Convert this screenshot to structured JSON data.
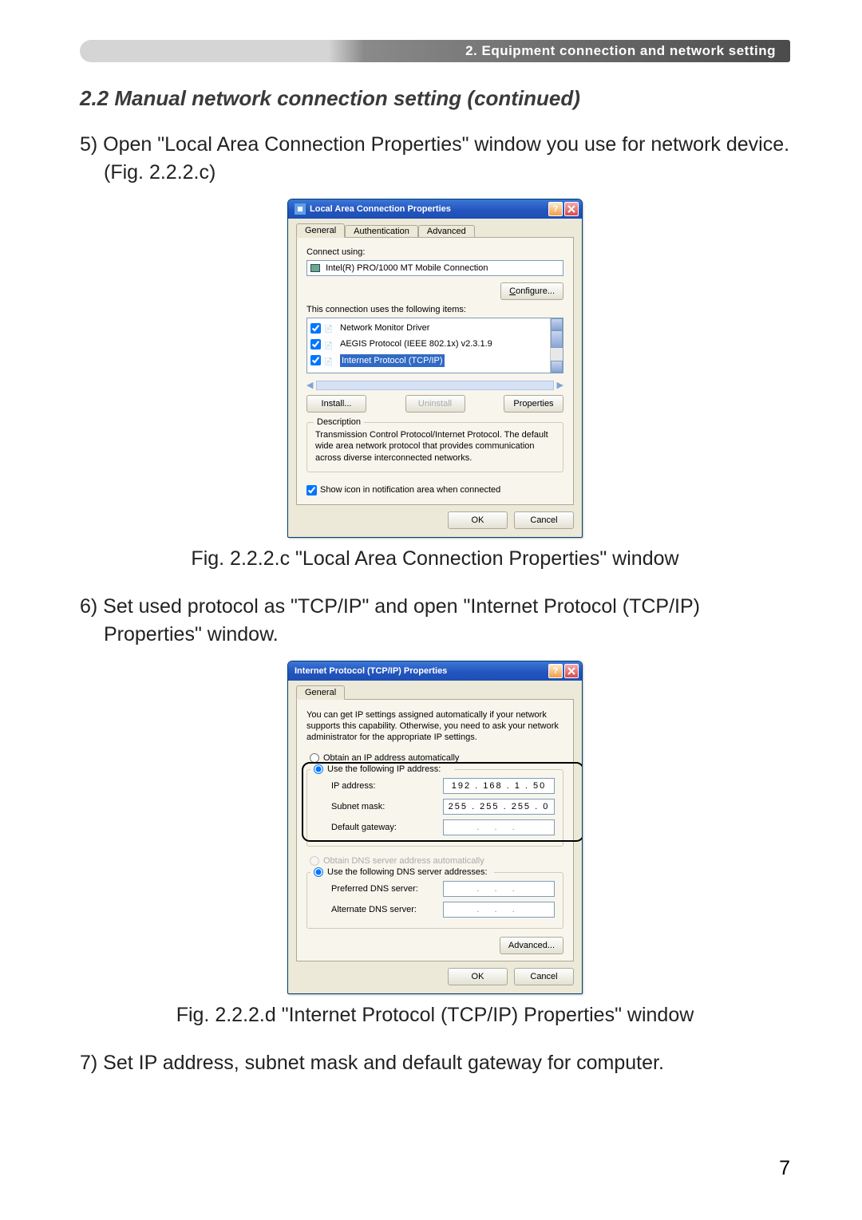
{
  "header": {
    "banner": "2. Equipment connection and network setting"
  },
  "heading": "2.2 Manual network connection setting (continued)",
  "step5": "5) Open \"Local Area Connection Properties\" window you use for network device. (Fig. 2.2.2.c)",
  "caption1": "Fig. 2.2.2.c \"Local Area Connection Properties\" window",
  "step6": "6) Set used protocol as \"TCP/IP\" and open \"Internet Protocol (TCP/IP) Properties\" window.",
  "caption2": "Fig. 2.2.2.d \"Internet Protocol (TCP/IP) Properties\" window",
  "step7": "7) Set IP address, subnet mask and default gateway for computer.",
  "page_number": "7",
  "dialog1": {
    "title": "Local Area Connection Properties",
    "tabs": [
      "General",
      "Authentication",
      "Advanced"
    ],
    "connect_using_label": "Connect using:",
    "adapter": "Intel(R) PRO/1000 MT Mobile Connection",
    "configure_btn": "Configure...",
    "items_label": "This connection uses the following items:",
    "items": [
      "Network Monitor Driver",
      "AEGIS Protocol (IEEE 802.1x) v2.3.1.9",
      "Internet Protocol (TCP/IP)"
    ],
    "install_btn": "Install...",
    "uninstall_btn": "Uninstall",
    "properties_btn": "Properties",
    "description_label": "Description",
    "description": "Transmission Control Protocol/Internet Protocol. The default wide area network protocol that provides communication across diverse interconnected networks.",
    "show_icon_label": "Show icon in notification area when connected",
    "ok": "OK",
    "cancel": "Cancel"
  },
  "dialog2": {
    "title": "Internet Protocol (TCP/IP) Properties",
    "tab": "General",
    "intro": "You can get IP settings assigned automatically if your network supports this capability. Otherwise, you need to ask your network administrator for the appropriate IP settings.",
    "obtain_ip": "Obtain an IP address automatically",
    "use_ip": "Use the following IP address:",
    "ip_label": "IP address:",
    "ip_value": "192 . 168 .   1 .  50",
    "subnet_label": "Subnet mask:",
    "subnet_value": "255 . 255 . 255 .   0",
    "gateway_label": "Default gateway:",
    "gateway_value": ".   .   .",
    "obtain_dns": "Obtain DNS server address automatically",
    "use_dns": "Use the following DNS server addresses:",
    "pref_dns_label": "Preferred DNS server:",
    "alt_dns_label": "Alternate DNS server:",
    "dns_empty": ".   .   .",
    "advanced_btn": "Advanced...",
    "ok": "OK",
    "cancel": "Cancel"
  }
}
